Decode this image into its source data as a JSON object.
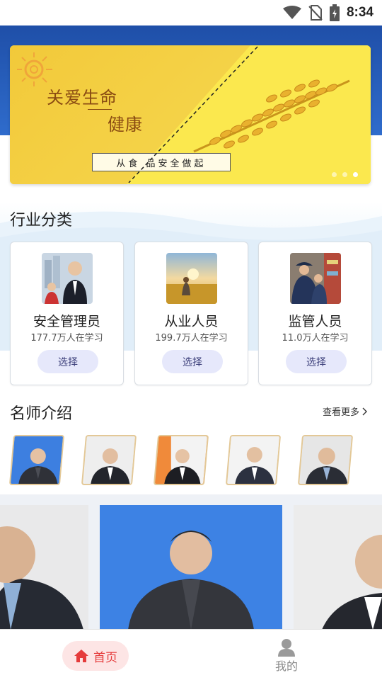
{
  "status_bar": {
    "time": "8:34"
  },
  "banner": {
    "title_line1": "关爱生命",
    "title_line2": "健康",
    "slogan": "从食 品安全做起",
    "page_indicator_count": 3,
    "active_page": 3
  },
  "industry_section": {
    "title": "行业分类",
    "cards": [
      {
        "name": "安全管理员",
        "count": "177.7万人在学习",
        "button": "选择"
      },
      {
        "name": "从业人员",
        "count": "199.7万人在学习",
        "button": "选择"
      },
      {
        "name": "监管人员",
        "count": "11.0万人在学习",
        "button": "选择"
      }
    ]
  },
  "teacher_section": {
    "title": "名师介绍",
    "more_label": "查看更多"
  },
  "bottom_nav": {
    "home_label": "首页",
    "mine_label": "我的"
  },
  "colors": {
    "header_blue": "#2f6ccc",
    "accent_red": "#e53b3b",
    "select_button_bg": "#e6e8fb",
    "banner_yellow": "#f7dc55"
  },
  "icons": [
    "wifi-icon",
    "no-sim-icon",
    "battery-icon",
    "home-icon",
    "user-icon",
    "chevron-right-icon"
  ]
}
